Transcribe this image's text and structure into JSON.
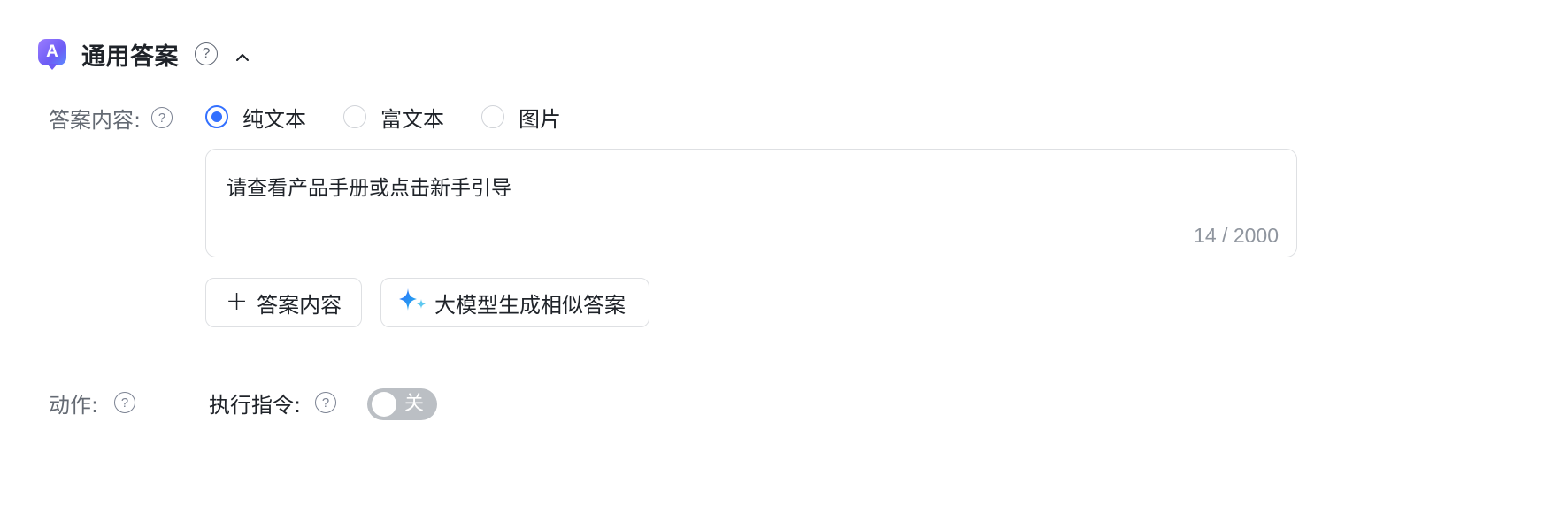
{
  "header": {
    "logo_letter": "A",
    "title": "通用答案",
    "help_glyph": "?",
    "collapse_icon": "chevron-up-icon"
  },
  "answer_content": {
    "label": "答案内容:",
    "help_glyph": "?",
    "radio_options": [
      {
        "label": "纯文本",
        "checked": true
      },
      {
        "label": "富文本",
        "checked": false
      },
      {
        "label": "图片",
        "checked": false
      }
    ],
    "textarea_value": "请查看产品手册或点击新手引导",
    "counter": "14 / 2000",
    "add_button_icon": "+",
    "add_button_label": "答案内容",
    "ai_button_label": "大模型生成相似答案",
    "ai_button_icon": "sparkle-icon"
  },
  "actions": {
    "label": "动作:",
    "help_glyph": "?",
    "exec_label": "执行指令:",
    "exec_help_glyph": "?",
    "switch_text": "关",
    "switch_on": false
  },
  "colors": {
    "accent": "#3370ff",
    "switch_off": "#bbbfc4",
    "logo_gradient_start": "#9b7dff",
    "logo_gradient_end": "#5b8cff"
  }
}
